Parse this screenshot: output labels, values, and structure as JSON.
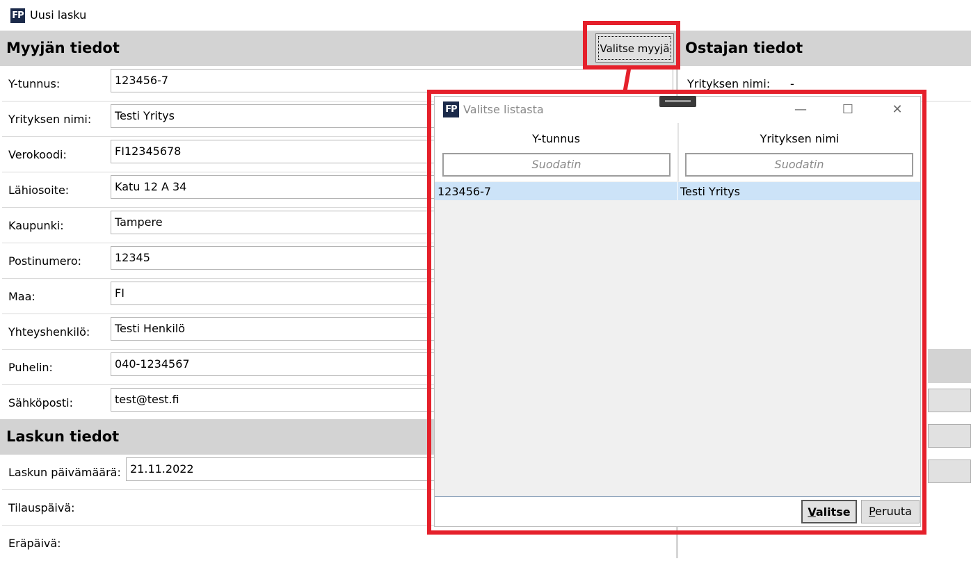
{
  "window": {
    "title": "Uusi lasku",
    "logo_text": "FP"
  },
  "seller": {
    "header": "Myyjän tiedot",
    "select_button": "Valitse myyjä",
    "fields": [
      {
        "label": "Y-tunnus:",
        "value": "123456-7"
      },
      {
        "label": "Yrityksen nimi:",
        "value": "Testi Yritys"
      },
      {
        "label": "Verokoodi:",
        "value": "FI12345678"
      },
      {
        "label": "Lähiosoite:",
        "value": "Katu 12 A 34"
      },
      {
        "label": "Kaupunki:",
        "value": "Tampere"
      },
      {
        "label": "Postinumero:",
        "value": "12345"
      },
      {
        "label": "Maa:",
        "value": "FI"
      },
      {
        "label": "Yhteyshenkilö:",
        "value": "Testi Henkilö"
      },
      {
        "label": "Puhelin:",
        "value": "040-1234567"
      },
      {
        "label": "Sähköposti:",
        "value": "test@test.fi"
      }
    ]
  },
  "invoice": {
    "header": "Laskun tiedot",
    "fields": [
      {
        "label": "Laskun päivämäärä:",
        "value": "21.11.2022"
      },
      {
        "label": "Tilauspäivä:",
        "value": ""
      },
      {
        "label": "Eräpäivä:",
        "value": ""
      }
    ]
  },
  "buyer": {
    "header": "Ostajan tiedot",
    "fields": [
      {
        "label": "Yrityksen nimi:",
        "value": "-"
      }
    ]
  },
  "dialog": {
    "title": "Valitse listasta",
    "logo_text": "FP",
    "columns": [
      "Y-tunnus",
      "Yrityksen nimi"
    ],
    "filter_placeholder": "Suodatin",
    "rows": [
      {
        "ytunnus": "123456-7",
        "name": "Testi Yritys",
        "selected": true
      }
    ],
    "select_button": {
      "mnemonic": "V",
      "rest": "alitse"
    },
    "cancel_button": {
      "mnemonic": "P",
      "rest": "eruuta"
    }
  },
  "colors": {
    "annotation": "#e5202b",
    "selection": "#cce3f8",
    "header_bg": "#d3d3d3"
  }
}
